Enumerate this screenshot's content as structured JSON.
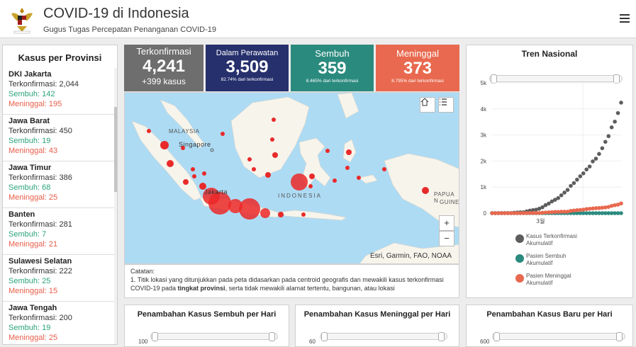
{
  "header": {
    "title": "COVID-19 di Indonesia",
    "subtitle": "Gugus Tugas Percepatan Penanganan COVID-19"
  },
  "provinces": {
    "title": "Kasus per Provinsi",
    "items": [
      {
        "name": "DKI Jakarta",
        "confirmed": "Terkonfirmasi: 2,044",
        "recovered": "Sembuh: 142",
        "deaths": "Meninggal: 195"
      },
      {
        "name": "Jawa Barat",
        "confirmed": "Terkonfirmasi: 450",
        "recovered": "Sembuh: 19",
        "deaths": "Meninggal: 43"
      },
      {
        "name": "Jawa Timur",
        "confirmed": "Terkonfirmasi: 386",
        "recovered": "Sembuh: 68",
        "deaths": "Meninggal: 25"
      },
      {
        "name": "Banten",
        "confirmed": "Terkonfirmasi: 281",
        "recovered": "Sembuh: 7",
        "deaths": "Meninggal: 21"
      },
      {
        "name": "Sulawesi Selatan",
        "confirmed": "Terkonfirmasi: 222",
        "recovered": "Sembuh: 25",
        "deaths": "Meninggal: 15"
      },
      {
        "name": "Jawa Tengah",
        "confirmed": "Terkonfirmasi: 200",
        "recovered": "Sembuh: 19",
        "deaths": "Meninggal: 25"
      }
    ]
  },
  "stats": {
    "confirmed": {
      "label": "Terkonfirmasi",
      "value": "4,241",
      "sub": "+399 kasus"
    },
    "treated": {
      "label": "Dalam Perawatan",
      "value": "3,509",
      "sub": "82.74% dari terkonfirmasi"
    },
    "recovered": {
      "label": "Sembuh",
      "value": "359",
      "sub": "8.465% dari terkonfirmasi"
    },
    "deaths": {
      "label": "Meninggal",
      "value": "373",
      "sub": "8.795% dari terkonfirmasi"
    }
  },
  "map": {
    "labels": {
      "malaysia": "MALAYSIA",
      "singapore": "Singapore",
      "jakarta": "Jakarta",
      "indonesia": "INDONESIA",
      "papua": "PAPUA N",
      "guinea": "GUINE"
    },
    "attribution": "Esri, Garmin, FAO, NOAA",
    "zoom_in": "+",
    "zoom_out": "−"
  },
  "notes": {
    "title": "Catatan:",
    "text_before": "1. Titik lokasi yang ditunjukkan pada peta didasarkan pada centroid geografis dan mewakili kasus terkonfirmasi COVID-19 pada ",
    "text_bold": "tingkat provinsi",
    "text_after": ", serta tidak mewakili alamat tertentu, bangunan, atau lokasi"
  },
  "trend": {
    "title": "Tren Nasional",
    "y_ticks": [
      "5k",
      "4k",
      "3k",
      "2k",
      "1k",
      "0"
    ],
    "x_tick": "3월",
    "legend": [
      {
        "label1": "Kasus Terkonfirmasi",
        "label2": "Akumulatif",
        "color": "#5d5d5d"
      },
      {
        "label1": "Pasien Sembuh",
        "label2": "Akumulatif",
        "color": "#2b8a7e"
      },
      {
        "label1": "Pasien Meninggal",
        "label2": "Akumulatif",
        "color": "#e8694f"
      }
    ]
  },
  "chart_data": {
    "type": "scatter",
    "title": "Tren Nasional",
    "ylim": [
      0,
      5000
    ],
    "series": [
      {
        "name": "Kasus Terkonfirmasi Akumulatif",
        "color": "#5d5d5d",
        "values": [
          2,
          2,
          2,
          4,
          4,
          4,
          6,
          19,
          27,
          34,
          34,
          69,
          96,
          117,
          134,
          172,
          227,
          309,
          369,
          450,
          514,
          579,
          686,
          790,
          893,
          1046,
          1155,
          1285,
          1414,
          1528,
          1677,
          1790,
          1986,
          2092,
          2273,
          2491,
          2738,
          2956,
          3293,
          3512,
          3842,
          4241
        ]
      },
      {
        "name": "Pasien Sembuh Akumulatif",
        "color": "#2b8a7e",
        "values": [
          0,
          0,
          0,
          0,
          0,
          0,
          0,
          0,
          0,
          0,
          0,
          0,
          0,
          0,
          0,
          0,
          0,
          0,
          0,
          0,
          0,
          0,
          0,
          0,
          0,
          0,
          0,
          0,
          0,
          0,
          0,
          0,
          0,
          0,
          0,
          0,
          0,
          0,
          0,
          0,
          0,
          0
        ]
      },
      {
        "name": "Pasien Meninggal Akumulatif",
        "color": "#e8694f",
        "values": [
          0,
          0,
          0,
          0,
          0,
          0,
          0,
          0,
          0,
          0,
          1,
          4,
          5,
          5,
          5,
          7,
          19,
          25,
          32,
          38,
          48,
          49,
          55,
          58,
          58,
          87,
          102,
          114,
          122,
          136,
          157,
          170,
          181,
          191,
          198,
          209,
          221,
          240,
          280,
          306,
          327,
          373
        ]
      }
    ]
  },
  "bottom": {
    "recovered_title": "Penambahan Kasus Sembuh per Hari",
    "recovered_tick": "100",
    "deaths_title": "Penambahan Kasus Meninggal per Hari",
    "deaths_tick": "60",
    "new_title": "Penambahan Kasus Baru per Hari",
    "new_tick": "600"
  }
}
